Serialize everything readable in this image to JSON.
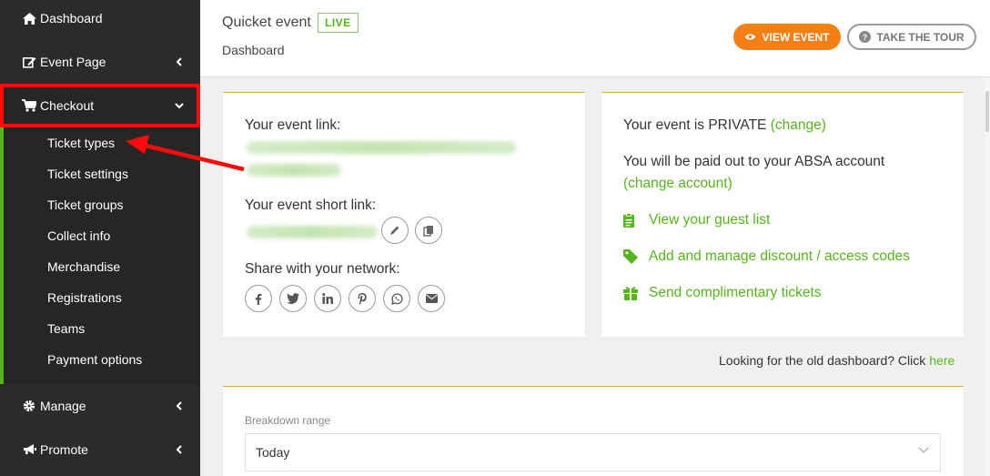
{
  "sidebar": {
    "dashboard": "Dashboard",
    "event_page": "Event Page",
    "checkout": "Checkout",
    "checkout_items": [
      "Ticket types",
      "Ticket settings",
      "Ticket groups",
      "Collect info",
      "Merchandise",
      "Registrations",
      "Teams",
      "Payment options"
    ],
    "manage": "Manage",
    "promote": "Promote"
  },
  "header": {
    "title": "Quicket event",
    "status_badge": "LIVE",
    "breadcrumb": "Dashboard",
    "view_event_label": "VIEW EVENT",
    "tour_label": "TAKE THE TOUR"
  },
  "link_card": {
    "event_link_label": "Your event link:",
    "short_link_label": "Your event short link:",
    "share_label": "Share with your network:",
    "share_icons": [
      "facebook-icon",
      "twitter-icon",
      "linkedin-icon",
      "pinterest-icon",
      "whatsapp-icon",
      "email-icon"
    ]
  },
  "info_card": {
    "privacy_text": "Your event is PRIVATE",
    "privacy_change": "(change)",
    "payout_text": "You will be paid out to your ABSA account",
    "payout_change": "(change account)",
    "actions": [
      "View your guest list",
      "Add and manage discount / access codes",
      "Send complimentary tickets"
    ]
  },
  "old_dashboard": {
    "text": "Looking for the old dashboard? Click",
    "link": "here"
  },
  "breakdown": {
    "label": "Breakdown range",
    "selected": "Today"
  },
  "colors": {
    "accent_green": "#55b51c",
    "accent_orange": "#f47f14",
    "highlight_red": "#ff0a0a",
    "sidebar_bg": "#2b2b2b"
  }
}
